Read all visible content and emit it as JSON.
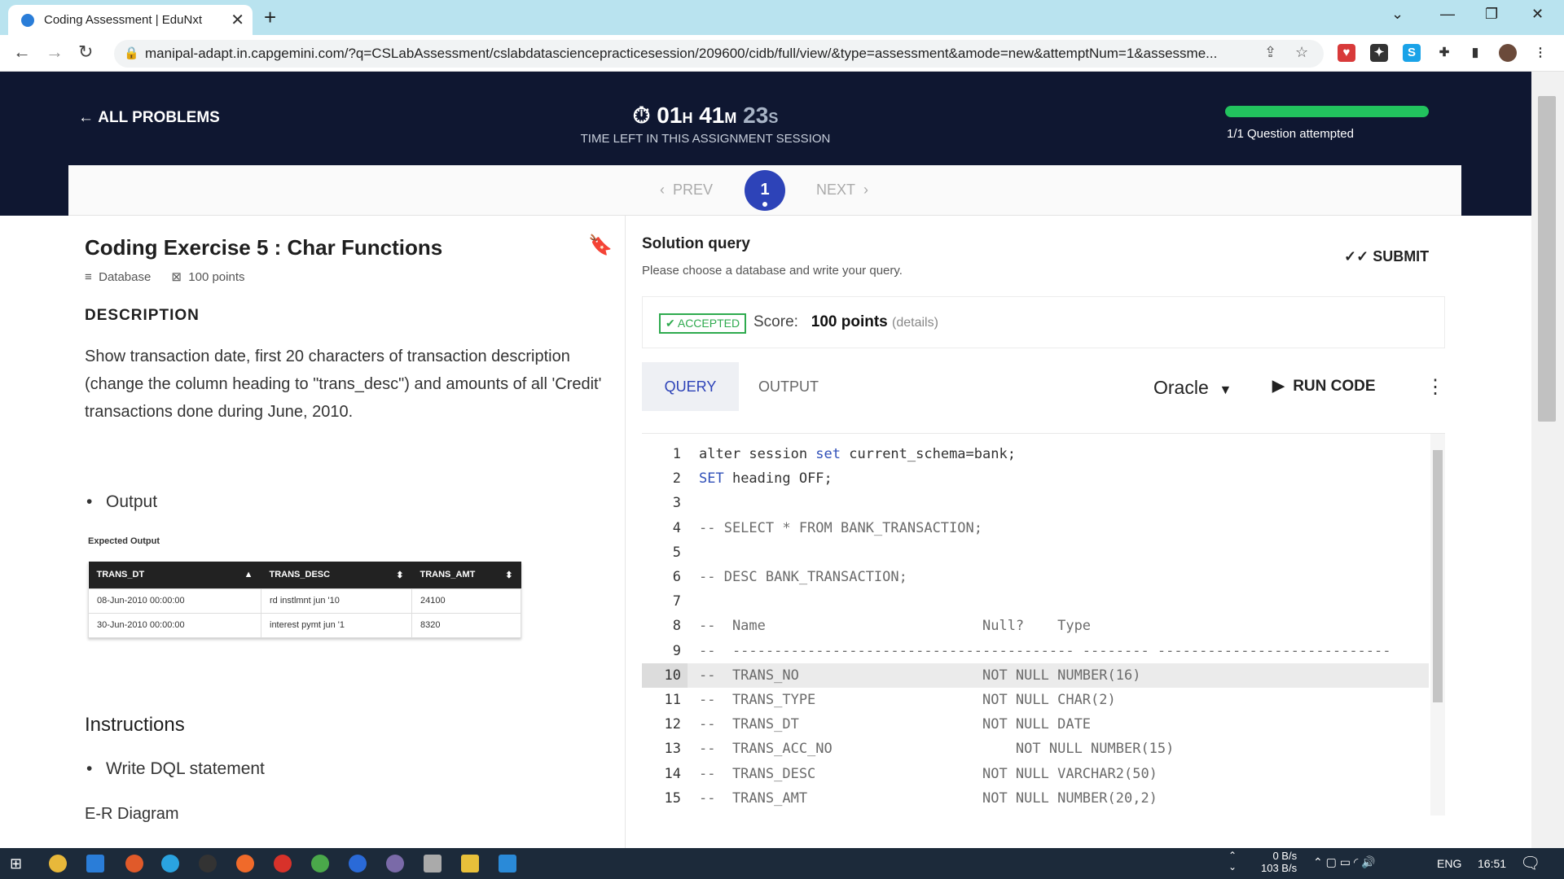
{
  "browser": {
    "tab_title": "Coding Assessment | EduNxt",
    "url": "manipal-adapt.in.capgemini.com/?q=CSLabAssessment/cslabdatasciencepracticesession/209600/cidb/full/view/&type=assessment&amode=new&attemptNum=1&assessme..."
  },
  "header": {
    "all_problems": "ALL PROBLEMS",
    "timer": {
      "h": "01",
      "m": "41",
      "s": "23",
      "h_unit": "H",
      "m_unit": "M",
      "s_unit": "S"
    },
    "time_label": "TIME LEFT IN THIS ASSIGNMENT SESSION",
    "progress_fraction": 1.0,
    "progress_text": "1/1 Question attempted"
  },
  "pager": {
    "prev": "PREV",
    "current": "1",
    "next": "NEXT"
  },
  "problem": {
    "title": "Coding Exercise 5 : Char Functions",
    "category": "Database",
    "points": "100 points",
    "description_heading": "DESCRIPTION",
    "description": "Show transaction date, first 20 characters of transaction description (change the column heading to \"trans_desc\") and amounts of all 'Credit' transactions done during June, 2010.",
    "output_bullet": "Output",
    "expected_label": "Expected Output",
    "expected_columns": [
      "TRANS_DT",
      "TRANS_DESC",
      "TRANS_AMT"
    ],
    "expected_rows": [
      [
        "08-Jun-2010 00:00:00",
        "rd instlmnt jun '10",
        "24100"
      ],
      [
        "30-Jun-2010 00:00:00",
        "interest pymt jun '1",
        "8320"
      ]
    ],
    "instructions_heading": "Instructions",
    "instructions_bullet": "Write DQL statement",
    "er_heading": "E-R Diagram"
  },
  "solution": {
    "heading": "Solution query",
    "subheading": "Please choose a database and write your query.",
    "submit": "SUBMIT",
    "status": "ACCEPTED",
    "score_label": "Score:",
    "score_value": "100 points",
    "score_details": "(details)",
    "tab_query": "QUERY",
    "tab_output": "OUTPUT",
    "database": "Oracle",
    "run_code": "RUN CODE"
  },
  "code": [
    {
      "n": "1",
      "parts": [
        [
          "",
          "alter session "
        ],
        [
          "kw",
          "set"
        ],
        [
          "",
          " current_schema=bank;"
        ]
      ]
    },
    {
      "n": "2",
      "parts": [
        [
          "kw",
          "SET"
        ],
        [
          "",
          " heading OFF;"
        ]
      ]
    },
    {
      "n": "3",
      "parts": []
    },
    {
      "n": "4",
      "parts": [
        [
          "cm",
          "-- SELECT * FROM BANK_TRANSACTION;"
        ]
      ]
    },
    {
      "n": "5",
      "parts": []
    },
    {
      "n": "6",
      "parts": [
        [
          "cm",
          "-- DESC BANK_TRANSACTION;"
        ]
      ]
    },
    {
      "n": "7",
      "parts": []
    },
    {
      "n": "8",
      "parts": [
        [
          "cm",
          "--  Name                          Null?    Type"
        ]
      ]
    },
    {
      "n": "9",
      "parts": [
        [
          "cm",
          "--  ----------------------------------------- -------- ----------------------------"
        ]
      ]
    },
    {
      "n": "10",
      "parts": [
        [
          "cm",
          "--  TRANS_NO                      NOT NULL NUMBER(16)"
        ]
      ]
    },
    {
      "n": "11",
      "parts": [
        [
          "cm",
          "--  TRANS_TYPE                    NOT NULL CHAR(2)"
        ]
      ]
    },
    {
      "n": "12",
      "parts": [
        [
          "cm",
          "--  TRANS_DT                      NOT NULL DATE"
        ]
      ]
    },
    {
      "n": "13",
      "parts": [
        [
          "cm",
          "--  TRANS_ACC_NO                      NOT NULL NUMBER(15)"
        ]
      ]
    },
    {
      "n": "14",
      "parts": [
        [
          "cm",
          "--  TRANS_DESC                    NOT NULL VARCHAR2(50)"
        ]
      ]
    },
    {
      "n": "15",
      "parts": [
        [
          "cm",
          "--  TRANS_AMT                     NOT NULL NUMBER(20,2)"
        ]
      ]
    }
  ],
  "active_line": "10",
  "taskbar": {
    "net_down": "0 B/s",
    "net_up": "103 B/s",
    "lang": "ENG",
    "time": "16:51"
  }
}
